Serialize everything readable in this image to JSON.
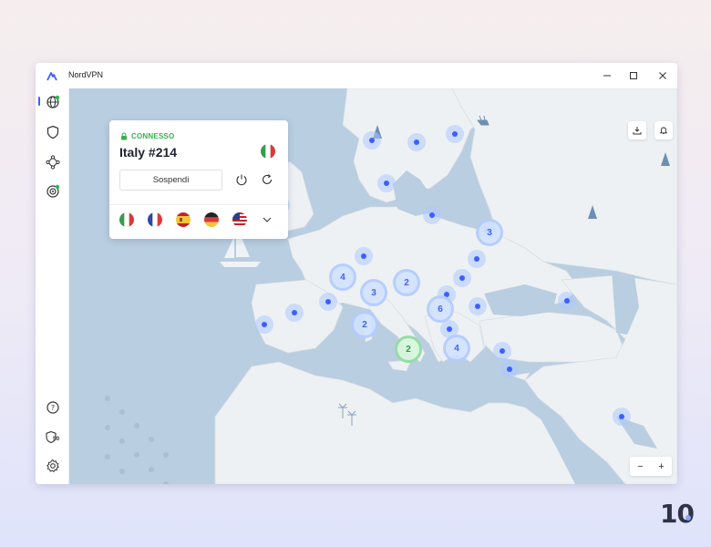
{
  "app": {
    "title": "NordVPN"
  },
  "window": {
    "minimize_icon": "minimize-icon",
    "maximize_icon": "maximize-icon",
    "close_icon": "close-icon"
  },
  "sidebar": {
    "items": [
      {
        "name": "globe-icon",
        "active": true
      },
      {
        "name": "shield-icon"
      },
      {
        "name": "meshnet-icon"
      },
      {
        "name": "target-icon"
      },
      {
        "name": "help-icon"
      },
      {
        "name": "shield-count-icon",
        "badge": "50"
      },
      {
        "name": "settings-icon"
      }
    ]
  },
  "connection": {
    "status": "CONNESSO",
    "server": "Italy #214",
    "pause_label": "Sospendi",
    "status_color": "#33b24d"
  },
  "quick_connect": {
    "countries": [
      "Italy",
      "France",
      "Spain",
      "Germany",
      "United States"
    ]
  },
  "map": {
    "clusters": [
      {
        "label": "4"
      },
      {
        "label": "3"
      },
      {
        "label": "2"
      },
      {
        "label": "6"
      },
      {
        "label": "2"
      },
      {
        "label": "2",
        "active": true
      },
      {
        "label": "4"
      },
      {
        "label": "3"
      }
    ]
  },
  "zoom": {
    "minus": "−",
    "plus": "+"
  },
  "brand": {
    "text": "10"
  },
  "colors": {
    "accent": "#3e5fff",
    "map_water": "#b9cee0",
    "map_land": "#eef1f3"
  }
}
